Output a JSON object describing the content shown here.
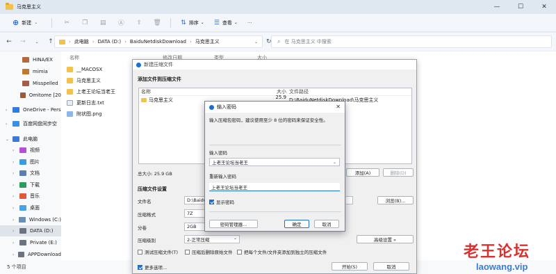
{
  "window": {
    "title": "马克思主义",
    "min": "—",
    "max": "☐",
    "close": "✕"
  },
  "toolbar": {
    "new_label": "新建",
    "sort_label": "排序",
    "view_label": "查看",
    "more": "···"
  },
  "address": {
    "crumbs": [
      "此电脑",
      "DATA (D:)",
      "BaiduNetdiskDownload",
      "马克思主义"
    ],
    "search_placeholder": "在 马克思主义 中搜索"
  },
  "sidebar": {
    "items": [
      {
        "label": "HINA/EX",
        "color": "#b06a3c"
      },
      {
        "label": "mimia",
        "color": "#c0782f"
      },
      {
        "label": "Misspelled",
        "color": "#a35d4a"
      },
      {
        "label": "Omitome [20",
        "color": "#9b5a3a"
      },
      {
        "label": "OneDrive - Pers",
        "color": "#2f7be0"
      },
      {
        "label": "百度网盘同步空",
        "color": "#3a8fe6"
      },
      {
        "label": "此电脑",
        "color": "#3a7ad5"
      },
      {
        "label": "视频",
        "color": "#b54fd6"
      },
      {
        "label": "图片",
        "color": "#3a9be0"
      },
      {
        "label": "文档",
        "color": "#5a7fb0"
      },
      {
        "label": "下载",
        "color": "#2a9d5a"
      },
      {
        "label": "音乐",
        "color": "#e0573a"
      },
      {
        "label": "桌面",
        "color": "#4aa3e0"
      },
      {
        "label": "Windows (C:)",
        "color": "#6a8fb8"
      },
      {
        "label": "DATA (D:)",
        "color": "#6a7480"
      },
      {
        "label": "Private (E:)",
        "color": "#6a7480"
      },
      {
        "label": "APPDownload",
        "color": "#6a7480"
      }
    ]
  },
  "content": {
    "columns": [
      "名称",
      "修改日期",
      "类型",
      "大小"
    ],
    "files": [
      {
        "name": "__MACOSX",
        "kind": "folder"
      },
      {
        "name": "马克思主义",
        "kind": "folder"
      },
      {
        "name": "上老王论坛当老王",
        "kind": "folder"
      },
      {
        "name": "更新日志.txt",
        "kind": "txt"
      },
      {
        "name": "附状图.png",
        "kind": "png"
      }
    ]
  },
  "status": {
    "count": "5 个项目"
  },
  "archive_dialog": {
    "title": "新建压缩文件",
    "add_section": "添加文件到压缩文件",
    "list_headers": [
      "名称",
      "大小",
      "文件路径"
    ],
    "row": {
      "name": "马克思主义",
      "size": "25.9 GB",
      "path": "D:\\BaiduNetdiskDownload\\马克思主义"
    },
    "total": "总大小: 25.9 GB",
    "add_btn": "添加(A)",
    "delete_btn": "删除(D)",
    "settings_section": "压缩文件设置",
    "filename_label": "文件名",
    "filename_value": "D:\\Baidu",
    "format_label": "压缩格式",
    "format_value": "7Z",
    "split_label": "分卷",
    "split_value": "2GB",
    "level_label": "压缩级别",
    "level_value": "2-正常压缩",
    "browse_btn": "浏览(B)...",
    "advanced_btn": "高级设置 »",
    "test_label": "测试压缩文件(T)",
    "delete_src_label": "压缩后删除原始文件",
    "separate_label": "把每个文件/文件夹添加到独立的压缩文件",
    "more_label": "更多选项...",
    "start_btn": "开始(S)",
    "cancel_btn": "取消"
  },
  "password_dialog": {
    "title": "输入密码",
    "instruction": "输入压缩包密码，建议使用至少 8 位的密码来保证安全性。",
    "pw_label": "输入密码",
    "pw_value": "上老王论坛当老王",
    "repeat_label": "重新输入密码",
    "repeat_value": "上老王论坛当老王",
    "show_label": "显示密码",
    "manager_btn": "密码管理器...",
    "ok_btn": "确定",
    "cancel_btn": "取消"
  },
  "watermark": {
    "text": "老王论坛",
    "url": "laowang.vip"
  }
}
